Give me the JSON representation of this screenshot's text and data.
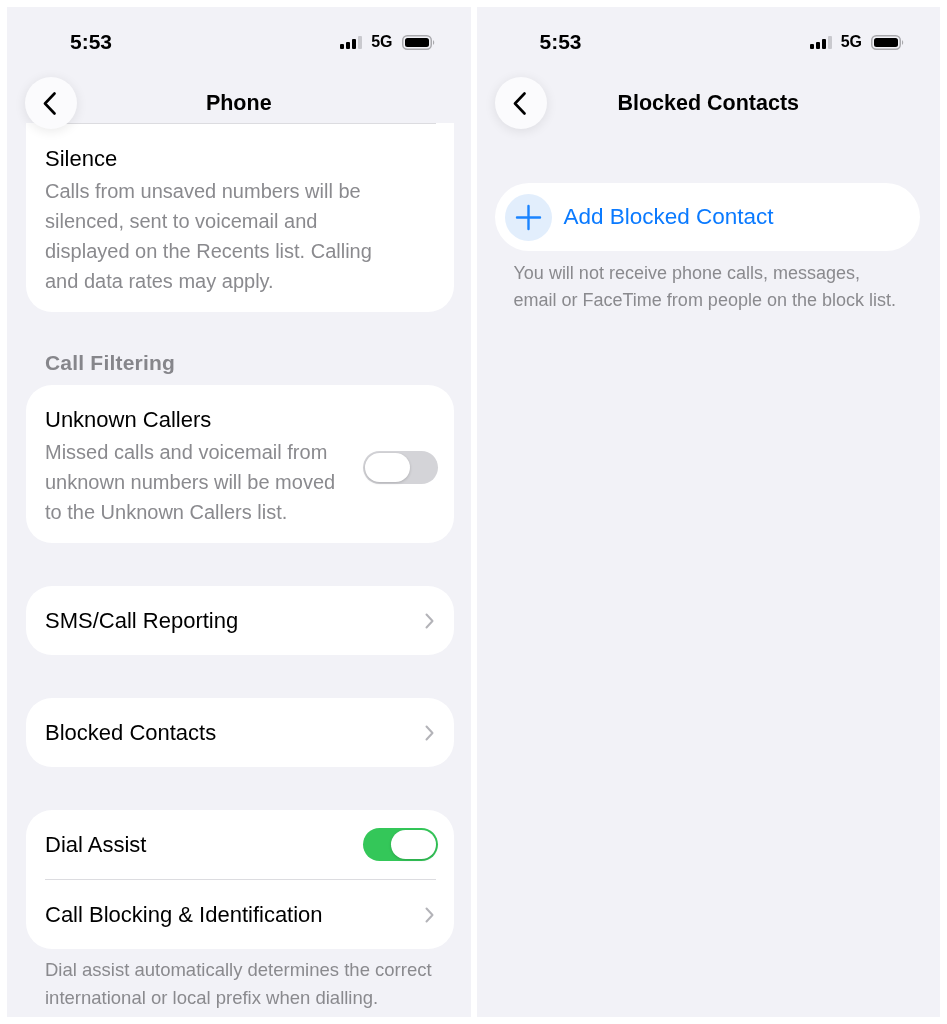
{
  "screens": [
    {
      "status_bar": {
        "time": "5:53",
        "network": "5G"
      },
      "title": "Phone",
      "groups": [
        {
          "continued": true,
          "items": [
            {
              "kind": "text",
              "title": "Silence",
              "description": "Calls from unsaved numbers will be silenced, sent to voicemail and displayed on the Recents list. Calling and data rates may apply."
            }
          ]
        },
        {
          "continued": false,
          "header": "Call Filtering",
          "items": [
            {
              "kind": "toggle",
              "title": "Unknown Callers",
              "description": "Missed calls and voicemail from unknown numbers will be moved to the Unknown Callers list.",
              "on": false
            }
          ]
        },
        {
          "continued": false,
          "items": [
            {
              "kind": "link",
              "title": "SMS/Call Reporting"
            }
          ]
        },
        {
          "continued": false,
          "items": [
            {
              "kind": "link",
              "title": "Blocked Contacts"
            }
          ]
        },
        {
          "continued": false,
          "items": [
            {
              "kind": "toggle",
              "title": "Dial Assist",
              "on": true
            },
            {
              "kind": "link",
              "title": "Call Blocking & Identification"
            }
          ],
          "footer": "Dial assist automatically determines the correct international or local prefix when dialling."
        }
      ]
    },
    {
      "status_bar": {
        "time": "5:53",
        "network": "5G"
      },
      "title": "Blocked Contacts",
      "groups": [
        {
          "continued": false,
          "items": [
            {
              "kind": "action",
              "title": "Add Blocked Contact"
            }
          ],
          "footer": "You will not receive phone calls, messages, email or FaceTime from people on the block list."
        }
      ]
    }
  ]
}
